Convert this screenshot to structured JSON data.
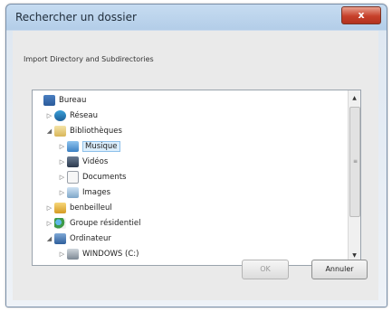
{
  "window": {
    "title": "Rechercher un dossier",
    "close_glyph": "x"
  },
  "description": "Import Directory and Subdirectories",
  "tree": {
    "items": [
      {
        "label": "Bureau",
        "icon": "desktop-icon",
        "arrow": ""
      },
      {
        "label": "Réseau",
        "icon": "network-icon",
        "arrow": "▷"
      },
      {
        "label": "Bibliothèques",
        "icon": "libraries-icon",
        "arrow": "◢"
      },
      {
        "label": "Musique",
        "icon": "music-icon",
        "arrow": "▷"
      },
      {
        "label": "Vidéos",
        "icon": "video-icon",
        "arrow": "▷"
      },
      {
        "label": "Documents",
        "icon": "documents-icon",
        "arrow": "▷"
      },
      {
        "label": "Images",
        "icon": "images-icon",
        "arrow": "▷"
      },
      {
        "label": "benbeilleul",
        "icon": "user-folder-icon",
        "arrow": "▷"
      },
      {
        "label": "Groupe résidentiel",
        "icon": "homegroup-icon",
        "arrow": "▷"
      },
      {
        "label": "Ordinateur",
        "icon": "computer-icon",
        "arrow": "◢"
      },
      {
        "label": "WINDOWS (C:)",
        "icon": "drive-icon",
        "arrow": "▷"
      }
    ],
    "selected": "Musique"
  },
  "buttons": {
    "ok": "OK",
    "cancel": "Annuler"
  },
  "colors": {
    "selection": "#dbeefc",
    "close_button": "#c7402a"
  }
}
